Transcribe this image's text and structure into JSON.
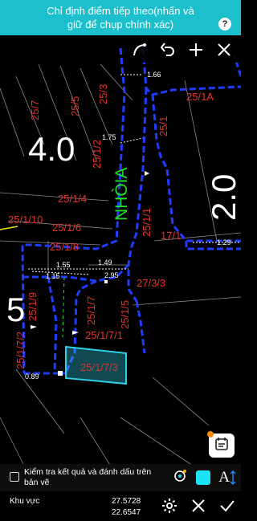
{
  "banner": {
    "line1": "Chỉ định điểm tiếp theo(nhấn và",
    "line2": "giữ để chụp chính xác)",
    "help": "?"
  },
  "toolbar": {
    "icons": [
      "curve-tool-icon",
      "undo-icon",
      "add-point-icon",
      "close-icon"
    ]
  },
  "map": {
    "street_name": "NHÒIA",
    "zone_labels": [
      "4.0",
      "5",
      "2.0"
    ],
    "parcels": [
      "25/7",
      "25/5",
      "25/3",
      "25/1A",
      "25/1/2",
      "25/1",
      "25/1/4",
      "25/1/10",
      "25/1/6",
      "25/1/8",
      "25/1/1",
      "17/1",
      "27/3/3",
      "25/1/9",
      "25/1/7",
      "25/1/5",
      "25/1/7/1",
      "25/1/7/2",
      "25/1/7/3"
    ],
    "measurements": [
      "1.66",
      "1.75",
      "1.29",
      "1.55",
      "1.49",
      "1.15",
      "2.95",
      "0.89"
    ],
    "colors": {
      "parcel_label": "#e8302a",
      "boundary": "#1f3cff",
      "street": "#22e02a",
      "highlight": "#2fd0e8"
    }
  },
  "notes_button": {
    "icon": "notes-icon"
  },
  "check_option": {
    "label": "Kiểm tra kết quả và đánh dấu trên bản vẽ",
    "checked": false
  },
  "bottom": {
    "area_label": "Khu vực",
    "value1": "27.5728",
    "value2": "22.6547",
    "icons": [
      "settings-icon",
      "cancel-icon",
      "confirm-icon"
    ]
  }
}
